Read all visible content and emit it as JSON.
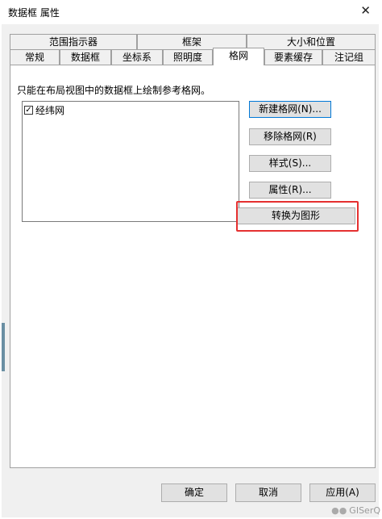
{
  "window": {
    "title": "数据框 属性",
    "close_glyph": "✕"
  },
  "tabs": {
    "row1": [
      {
        "label": "范围指示器"
      },
      {
        "label": "框架"
      },
      {
        "label": "大小和位置"
      }
    ],
    "row2": [
      {
        "label": "常规"
      },
      {
        "label": "数据框"
      },
      {
        "label": "坐标系"
      },
      {
        "label": "照明度"
      },
      {
        "label": "格网",
        "active": true
      },
      {
        "label": "要素缓存"
      },
      {
        "label": "注记组"
      }
    ]
  },
  "panel": {
    "description": "只能在布局视图中的数据框上绘制参考格网。",
    "list": [
      {
        "label": "经纬网",
        "checked": true,
        "check_glyph": "✓"
      }
    ],
    "buttons": {
      "new": "新建格网(N)...",
      "remove": "移除格网(R)",
      "style": "样式(S)...",
      "properties": "属性(R)...",
      "convert": "转换为图形"
    }
  },
  "footer": {
    "ok": "确定",
    "cancel": "取消",
    "apply": "应用(A)"
  },
  "watermark": {
    "text": "GISerQ"
  },
  "colors": {
    "highlight": "#e53030",
    "accent": "#0078d7"
  }
}
